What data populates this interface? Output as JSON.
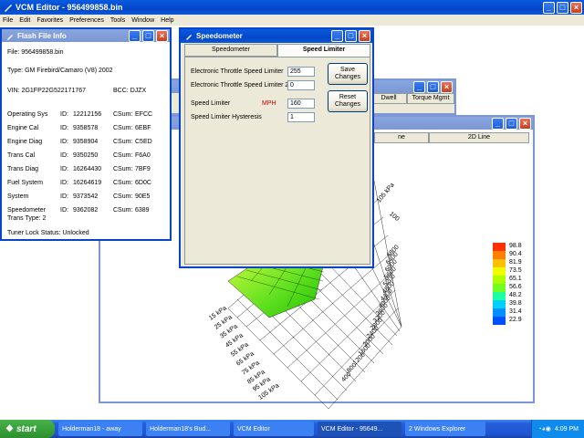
{
  "app": {
    "title": "VCM Editor - 956499858.bin",
    "menu": [
      "File",
      "Edit",
      "Favorites",
      "Preferences",
      "Tools",
      "Window",
      "Help"
    ]
  },
  "flash_info": {
    "title": "Flash File Info",
    "file_label": "File:",
    "file": "956499858.bin",
    "type_label": "Type:",
    "type": "GM Firebird/Camaro (V8) 2002",
    "vin_label": "VIN:",
    "vin": "2G1FP22G522171767",
    "bcc_label": "BCC:",
    "bcc": "DJZX",
    "id_label": "ID:",
    "csum_label": "CSum:",
    "modules": [
      {
        "name": "Operating Sys",
        "id": "12212156",
        "csum": "EFCC"
      },
      {
        "name": "Engine Cal",
        "id": "9358578",
        "csum": "6EBF"
      },
      {
        "name": "Engine Diag",
        "id": "9358904",
        "csum": "C5ED"
      },
      {
        "name": "Trans Cal",
        "id": "9350250",
        "csum": "F6A0"
      },
      {
        "name": "Trans Diag",
        "id": "16264430",
        "csum": "7BF9"
      },
      {
        "name": "Fuel System",
        "id": "16264619",
        "csum": "6D0C"
      },
      {
        "name": "System",
        "id": "9373542",
        "csum": "90E5"
      },
      {
        "name": "Speedometer",
        "id": "9362082",
        "csum": "6389"
      }
    ],
    "trans_type_label": "Trans Type:",
    "trans_type": "2",
    "tuner_lock_label": "Tuner Lock Status:",
    "tuner_lock": "Unlocked"
  },
  "speedo": {
    "title": "Speedometer",
    "tabs": [
      "Speedometer",
      "Speed Limiter"
    ],
    "fields": [
      {
        "label": "Electronic Throttle Speed Limiter",
        "value": "255"
      },
      {
        "label": "Electronic Throttle Speed Limiter 2",
        "value": "0"
      },
      {
        "label": "Speed Limiter",
        "unit": "MPH",
        "value": "160"
      },
      {
        "label": "Speed Limiter Hysteresis",
        "value": "1"
      }
    ],
    "save_label": "Save Changes",
    "reset_label": "Reset Changes"
  },
  "back_tabs": [
    "Dwell",
    "Torque Mgmt",
    "2D Line"
  ],
  "legend": [
    "98.8",
    "90.4",
    "81.9",
    "73.5",
    "65.1",
    "56.6",
    "48.2",
    "39.8",
    "31.4",
    "22.9"
  ],
  "legend_colors": [
    "#ff3000",
    "#ff8000",
    "#ffc000",
    "#f0ff00",
    "#b0ff00",
    "#70ff20",
    "#20ffa0",
    "#00d0ff",
    "#0090ff",
    "#0050ff"
  ],
  "axis_kpa": [
    "15 kPa",
    "25 kPa",
    "35 kPa",
    "45 kPa",
    "55 kPa",
    "65 kPa",
    "75 kPa",
    "85 kPa",
    "95 kPa",
    "105 kPa"
  ],
  "axis_rpm": [
    "400",
    "800",
    "1200",
    "1600",
    "2000",
    "2400",
    "2800",
    "3200",
    "3600",
    "4000",
    "4400",
    "4800",
    "5200",
    "5600",
    "6000",
    "6400",
    "6800"
  ],
  "axis_top": [
    "100",
    "105 kPa"
  ],
  "taskbar": {
    "start": "start",
    "tasks": [
      "Holderman18 - away",
      "Holderman18's Bud...",
      "VCM Editor",
      "VCM Editor - 95649...",
      "2 Windows Explorer"
    ],
    "clock": "4:09 PM"
  }
}
